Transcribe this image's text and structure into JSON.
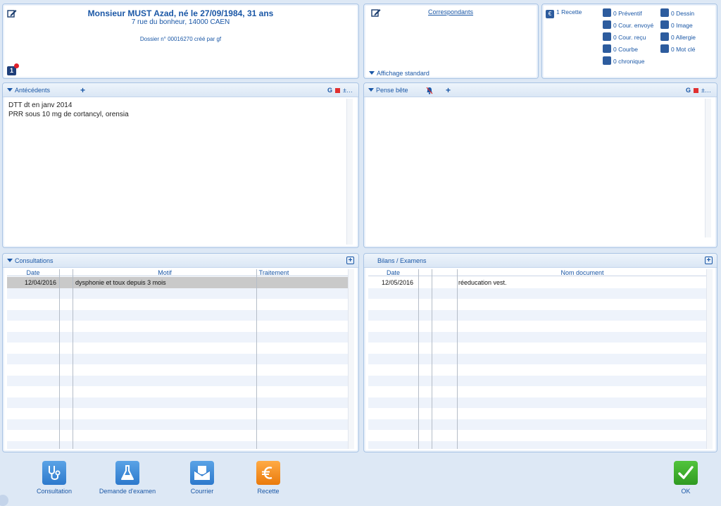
{
  "patient": {
    "name_line": "Monsieur MUST Azad, né le 27/09/1984, 31 ans",
    "address": "7 rue du bonheur, 14000 CAEN",
    "dossier": "Dossier n° 00016270 créé par gf",
    "badge": "1"
  },
  "correspondants": {
    "link": "Correspondants",
    "display_mode": "Affichage standard"
  },
  "counters": [
    {
      "label": "1 Recette",
      "icon": "euro-icon"
    },
    {
      "label": "0 Préventif",
      "icon": "syringe-icon"
    },
    {
      "label": "0 Dessin",
      "icon": "drawing-icon"
    },
    {
      "label": "0 Cour. envoyé",
      "icon": "envelope-icon"
    },
    {
      "label": "0 Image",
      "icon": "camera-icon"
    },
    {
      "label": "0 Cour. reçu",
      "icon": "mail-received-icon"
    },
    {
      "label": "0 Allergie",
      "icon": "cat-icon"
    },
    {
      "label": "0 Courbe",
      "icon": "chart-icon"
    },
    {
      "label": "0 Mot clé",
      "icon": "key-icon"
    },
    {
      "label": "0 chronique",
      "icon": "pill-icon"
    }
  ],
  "antecedents": {
    "title": "Antécédents",
    "tool_g": "G",
    "tool_more": "±…",
    "lines": [
      "DTT dt en janv 2014",
      "PRR sous 10 mg de cortancyl, orensia"
    ]
  },
  "pense_bete": {
    "title": "Pense bête",
    "tool_g": "G",
    "tool_more": "±…"
  },
  "consultations": {
    "title": "Consultations",
    "columns": [
      "Date",
      "Motif",
      "Traitement"
    ],
    "rows": [
      {
        "date": "12/04/2016",
        "motif": "dysphonie et toux depuis 3 mois",
        "traitement": ""
      }
    ]
  },
  "bilans": {
    "title": "Bilans / Examens",
    "columns": [
      "Date",
      "Nom document"
    ],
    "rows": [
      {
        "date": "12/05/2016",
        "doc": "réeducation vest."
      }
    ]
  },
  "bottom_buttons": {
    "consultation": "Consultation",
    "exam": "Demande d'examen",
    "courrier": "Courrier",
    "recette": "Recette",
    "ok": "OK"
  },
  "colors": {
    "accent": "#1a57a6",
    "background": "#dde8f5",
    "ok_green": "#37a829",
    "recette_orange": "#f08a18"
  }
}
